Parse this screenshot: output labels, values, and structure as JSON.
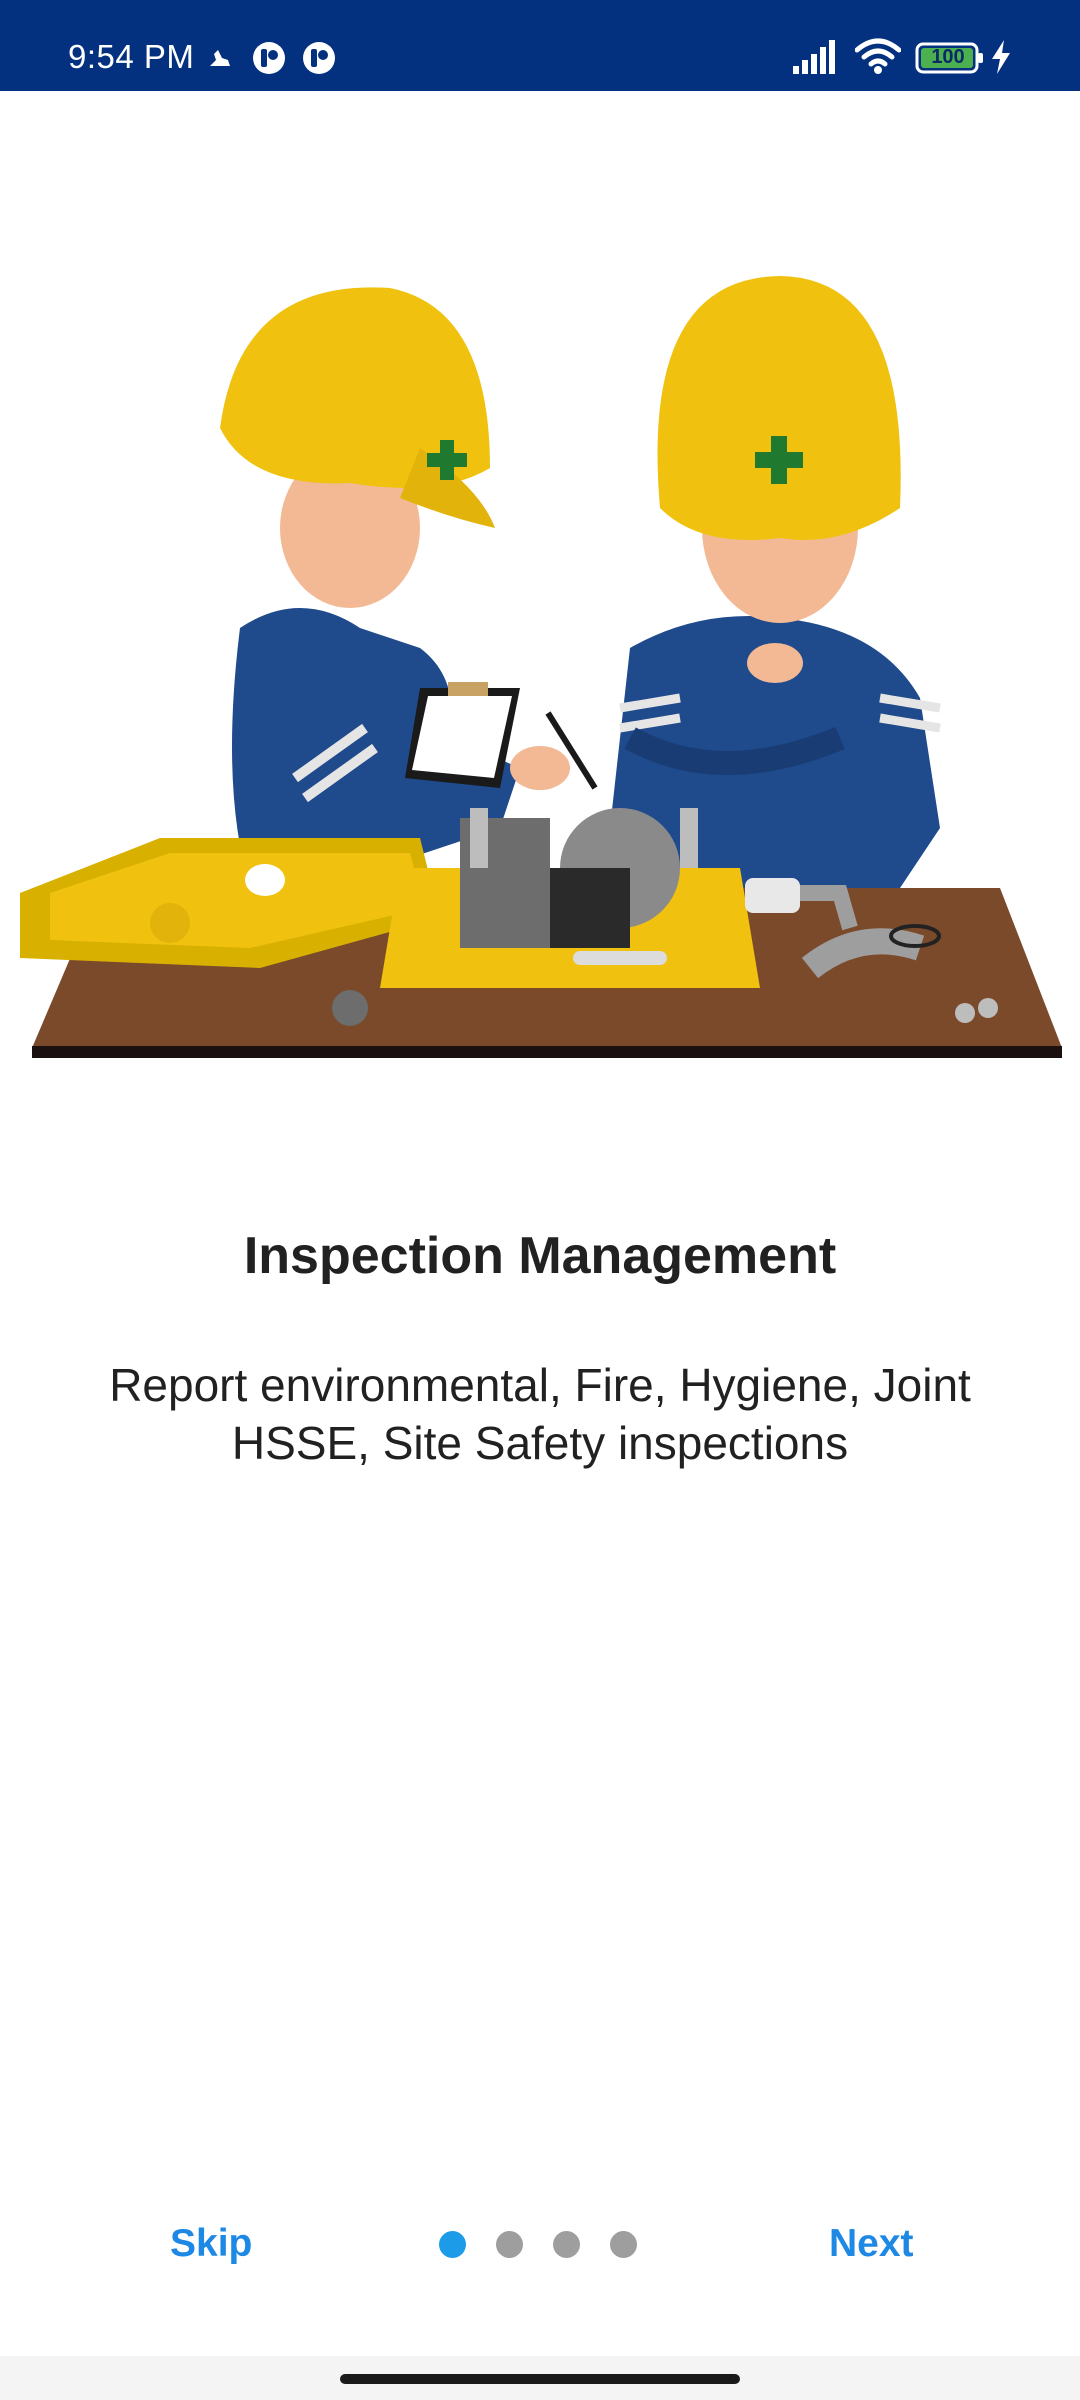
{
  "status_bar": {
    "time": "9:54 PM",
    "battery_level": "100",
    "icons": [
      "notification-icon",
      "app-icon",
      "app-icon",
      "signal-icon",
      "wifi-icon",
      "battery-icon",
      "charging-icon"
    ]
  },
  "onboarding": {
    "illustration": "two-inspectors-illustration",
    "title": "Inspection Management",
    "subtitle": "Report environmental, Fire, Hygiene, Joint HSSE, Site Safety inspections",
    "page_count": 4,
    "active_page": 1
  },
  "nav": {
    "skip_label": "Skip",
    "next_label": "Next"
  },
  "colors": {
    "status_bar": "#03307f",
    "accent": "#1e88e5",
    "active_dot": "#1b9be8",
    "inactive_dot": "#9e9e9e"
  }
}
